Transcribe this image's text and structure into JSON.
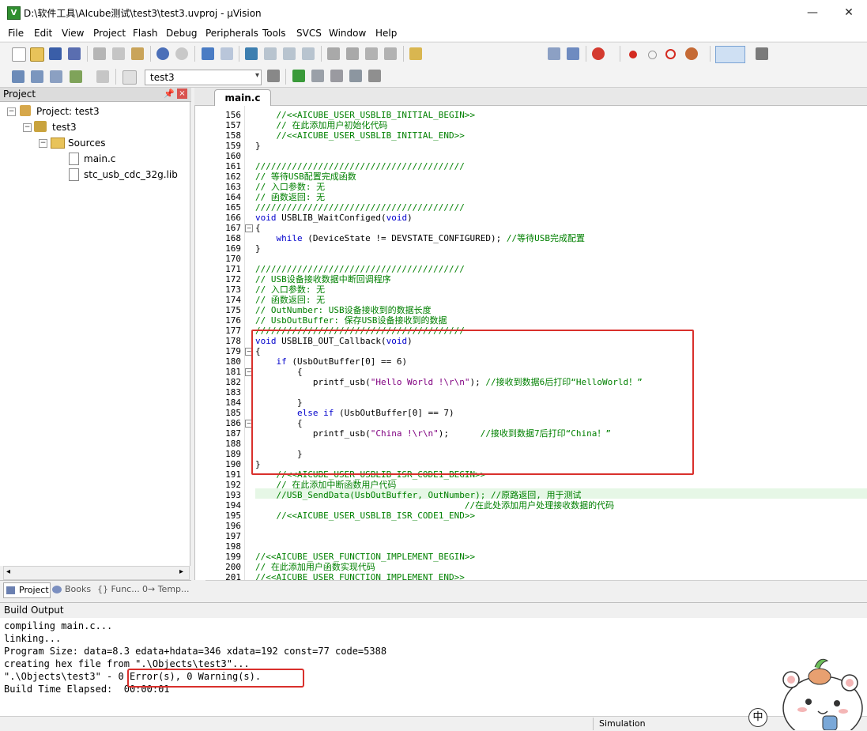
{
  "window": {
    "title": "D:\\软件工具\\AIcube测试\\test3\\test3.uvproj - µVision",
    "minimize": "—",
    "maximize": "☐",
    "close": "✕"
  },
  "menu": [
    "File",
    "Edit",
    "View",
    "Project",
    "Flash",
    "Debug",
    "Peripherals",
    "Tools",
    "SVCS",
    "Window",
    "Help"
  ],
  "toolbar": {
    "target_name": "test3"
  },
  "project_panel": {
    "title": "Project",
    "pin": "ᴾ",
    "close": "×",
    "tree": {
      "root": "Project: test3",
      "target": "test3",
      "group": "Sources",
      "files": [
        "main.c",
        "stc_usb_cdc_32g.lib"
      ]
    },
    "tabs": [
      "Project",
      "Books",
      "{} Func...",
      "0→ Temp..."
    ]
  },
  "editor": {
    "active_tab": "main.c",
    "lines": [
      {
        "n": "156",
        "text": "    //<<AICUBE_USER_USBLIB_INITIAL_BEGIN>>"
      },
      {
        "n": "157",
        "text": "    // 在此添加用户初始化代码"
      },
      {
        "n": "158",
        "text": "    //<<AICUBE_USER_USBLIB_INITIAL_END>>"
      },
      {
        "n": "159",
        "text": "}"
      },
      {
        "n": "160",
        "text": ""
      },
      {
        "n": "161",
        "text": "////////////////////////////////////////"
      },
      {
        "n": "162",
        "text": "// 等待USB配置完成函数"
      },
      {
        "n": "163",
        "text": "// 入口参数: 无"
      },
      {
        "n": "164",
        "text": "// 函数返回: 无"
      },
      {
        "n": "165",
        "text": "////////////////////////////////////////"
      },
      {
        "n": "166",
        "text": "void USBLIB_WaitConfiged(void)"
      },
      {
        "n": "167",
        "text": "{"
      },
      {
        "n": "168",
        "text": "    while (DeviceState != DEVSTATE_CONFIGURED); //等待USB完成配置"
      },
      {
        "n": "169",
        "text": "}"
      },
      {
        "n": "170",
        "text": ""
      },
      {
        "n": "171",
        "text": "////////////////////////////////////////"
      },
      {
        "n": "172",
        "text": "// USB设备接收数据中断回调程序"
      },
      {
        "n": "173",
        "text": "// 入口参数: 无"
      },
      {
        "n": "174",
        "text": "// 函数返回: 无"
      },
      {
        "n": "175",
        "text": "// OutNumber: USB设备接收到的数据长度"
      },
      {
        "n": "176",
        "text": "// UsbOutBuffer: 保存USB设备接收到的数据"
      },
      {
        "n": "177",
        "text": "////////////////////////////////////////"
      },
      {
        "n": "178",
        "text": "void USBLIB_OUT_Callback(void)"
      },
      {
        "n": "179",
        "text": "{"
      },
      {
        "n": "180",
        "text": "    if (UsbOutBuffer[0] == 6)"
      },
      {
        "n": "181",
        "text": "        {"
      },
      {
        "n": "182",
        "text": "           printf_usb(\"Hello World !\\r\\n\"); //接收到数据6后打印“HelloWorld！”"
      },
      {
        "n": "183",
        "text": ""
      },
      {
        "n": "184",
        "text": "        }"
      },
      {
        "n": "185",
        "text": "        else if (UsbOutBuffer[0] == 7)"
      },
      {
        "n": "186",
        "text": "        {"
      },
      {
        "n": "187",
        "text": "           printf_usb(\"China !\\r\\n\");      //接收到数据7后打印“China！”"
      },
      {
        "n": "188",
        "text": ""
      },
      {
        "n": "189",
        "text": "        }"
      },
      {
        "n": "190",
        "text": "}"
      },
      {
        "n": "191",
        "text": "    //<<AICUBE_USER_USBLIB_ISR_CODE1_BEGIN>>"
      },
      {
        "n": "192",
        "text": "    // 在此添加中断函数用户代码"
      },
      {
        "n": "193",
        "text": "    //USB_SendData(UsbOutBuffer, OutNumber); //原路返回, 用于测试"
      },
      {
        "n": "194",
        "text": "                                        //在此处添加用户处理接收数据的代码"
      },
      {
        "n": "195",
        "text": "    //<<AICUBE_USER_USBLIB_ISR_CODE1_END>>"
      },
      {
        "n": "196",
        "text": ""
      },
      {
        "n": "197",
        "text": ""
      },
      {
        "n": "198",
        "text": ""
      },
      {
        "n": "199",
        "text": "//<<AICUBE_USER_FUNCTION_IMPLEMENT_BEGIN>>"
      },
      {
        "n": "200",
        "text": "// 在此添加用户函数实现代码"
      },
      {
        "n": "201",
        "text": "//<<AICUBE_USER_FUNCTION_IMPLEMENT_END>>"
      }
    ]
  },
  "build_output": {
    "title": "Build Output",
    "lines": [
      "compiling main.c...",
      "linking...",
      "Program Size: data=8.3 edata+hdata=346 xdata=192 const=77 code=5388",
      "creating hex file from \".\\Objects\\test3\"...",
      "\".\\Objects\\test3\" - 0 Error(s), 0 Warning(s).",
      "Build Time Elapsed:  00:00:01"
    ]
  },
  "status": {
    "mode": "Simulation",
    "ime": "中"
  },
  "colors": {
    "highlight_box": "#d9302c",
    "comment": "#008000",
    "keyword": "#0000cc",
    "string": "#800080"
  }
}
